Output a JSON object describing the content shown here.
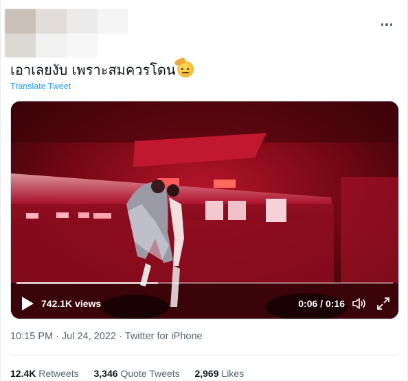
{
  "tweet": {
    "text": "เอาเลยงับ เพราะสมควรโดน",
    "emoji_icon": "saluting-face-emoji",
    "translate_label": "Translate Tweet",
    "more_icon": "more-horizontal-icon"
  },
  "video": {
    "views": "742.1K views",
    "current_time": "0:06",
    "duration": "0:16",
    "time_separator": " / ",
    "progress": 0.375,
    "icons": [
      "play-icon",
      "volume-icon",
      "fullscreen-icon"
    ]
  },
  "meta": {
    "time": "10:15 PM",
    "date": "Jul 24, 2022",
    "source": "Twitter for iPhone",
    "separator": "·"
  },
  "stats": {
    "retweets_count": "12.4K",
    "retweets_label": "Retweets",
    "quotes_count": "3,346",
    "quotes_label": "Quote Tweets",
    "likes_count": "2,969",
    "likes_label": "Likes"
  },
  "colors": {
    "link": "#1d9bf0",
    "secondary_text": "#536471",
    "primary_text": "#0f1419",
    "stage_red": "#c8102e"
  }
}
